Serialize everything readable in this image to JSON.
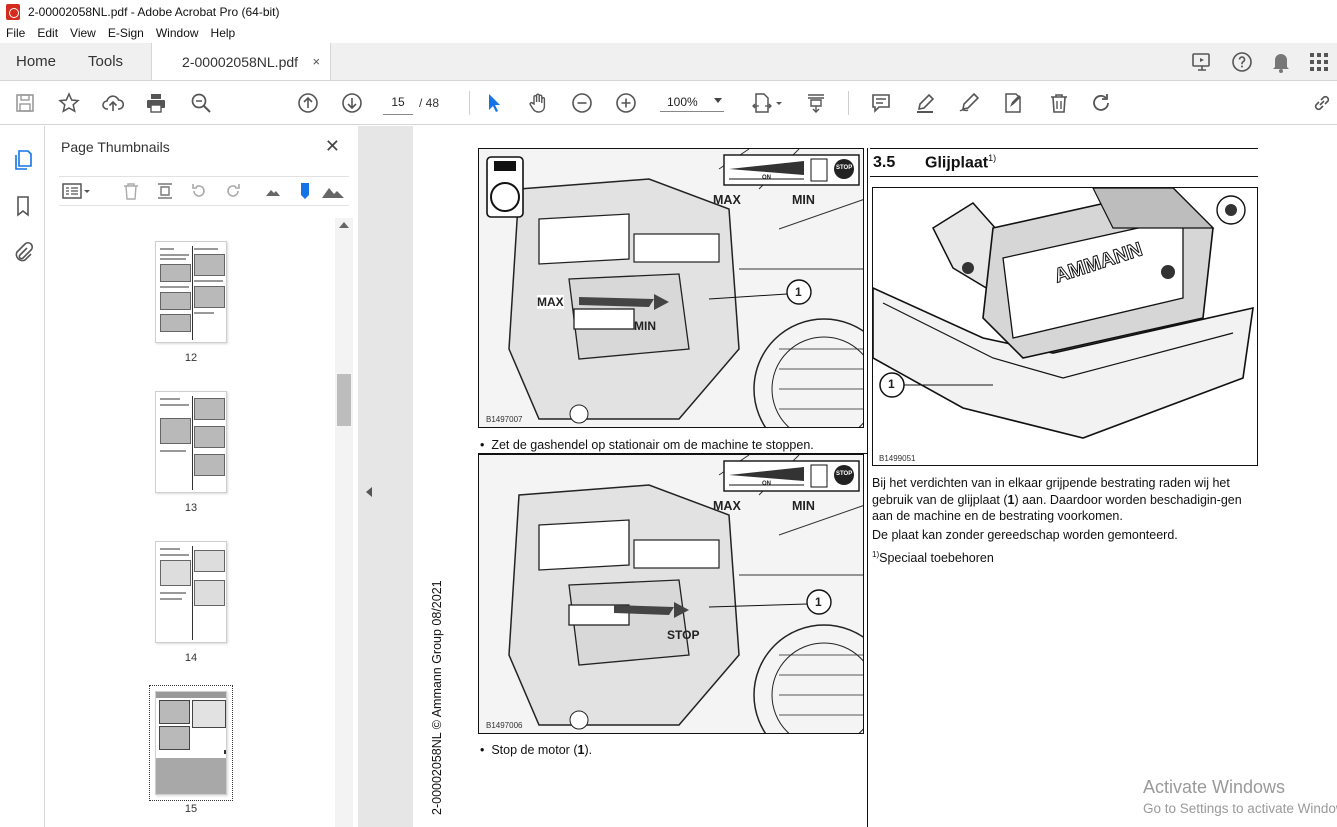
{
  "window": {
    "title": "2-00002058NL.pdf - Adobe Acrobat Pro (64-bit)"
  },
  "menu": [
    "File",
    "Edit",
    "View",
    "E-Sign",
    "Window",
    "Help"
  ],
  "tabs": {
    "home": "Home",
    "tools": "Tools",
    "document": "2-00002058NL.pdf",
    "close": "×"
  },
  "toolbar": {
    "page_current": "15",
    "page_total": "/ 48",
    "zoom": "100%"
  },
  "panel": {
    "title": "Page Thumbnails",
    "close": "✕",
    "thumbnails": [
      {
        "label": "12"
      },
      {
        "label": "13"
      },
      {
        "label": "14"
      },
      {
        "label": "15",
        "selected": true
      }
    ]
  },
  "document": {
    "side_text": "2-00002058NL © Ammann Group  08/2021",
    "figure1": {
      "max": "MAX",
      "min": "MIN",
      "max2": "MAX",
      "min2": "MIN",
      "on": "ON",
      "stop": "STOP",
      "callout": "1",
      "code": "B1497007"
    },
    "bullet1": "Zet de gashendel op stationair om de machine te stoppen.",
    "figure2": {
      "max": "MAX",
      "min": "MIN",
      "stop_label": "STOP",
      "on": "ON",
      "stop": "STOP",
      "callout": "1",
      "code": "B1497006"
    },
    "bullet2_prefix": "Stop de motor (",
    "bullet2_bold": "1",
    "bullet2_suffix": ").",
    "section": {
      "number": "3.5",
      "title": "Glijplaat",
      "footnote_mark": "1)"
    },
    "figure3": {
      "brand": "AMMANN",
      "callout": "1",
      "code": "B1499051"
    },
    "para1_a": "Bij het verdichten van in elkaar grijpende bestrating raden wij het gebruik van de glijplaat (",
    "para1_bold": "1",
    "para1_b": ") aan. Daardoor worden beschadigin-gen aan de machine en de bestrating voorkomen.",
    "para2": "De plaat kan zonder gereedschap worden gemonteerd.",
    "footnote_mark": "1)",
    "footnote": "Speciaal toebehoren"
  },
  "watermark": {
    "line1": "Activate Windows",
    "line2": "Go to Settings to activate Windows."
  },
  "colors": {
    "accent": "#1473e6",
    "acrobat_red": "#d52b1e"
  }
}
